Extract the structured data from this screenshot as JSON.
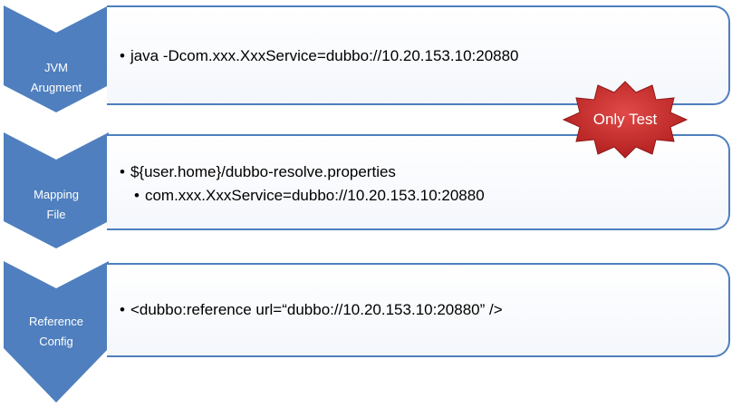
{
  "steps": [
    {
      "label_lines": [
        "JVM",
        "Arugment"
      ],
      "bullets": [
        "java -Dcom.xxx.XxxService=dubbo://10.20.153.10:20880"
      ]
    },
    {
      "label_lines": [
        "Mapping",
        "File"
      ],
      "bullets": [
        "${user.home}/dubbo-resolve.properties"
      ],
      "sub_bullets": [
        "com.xxx.XxxService=dubbo://10.20.153.10:20880"
      ]
    },
    {
      "label_lines": [
        "Reference",
        "Config"
      ],
      "bullets": [
        "<dubbo:reference url=“dubbo://10.20.153.10:20880” />"
      ]
    }
  ],
  "badge": {
    "text": "Only Test"
  },
  "colors": {
    "chevron": "#4f7fbe",
    "box_border": "#4f7fbe",
    "badge": "#c0282a"
  },
  "bullet_symbol": "•"
}
